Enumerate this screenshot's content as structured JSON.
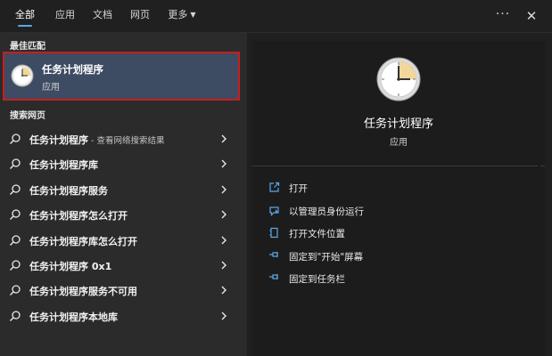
{
  "tabs": [
    {
      "label": "全部",
      "active": true
    },
    {
      "label": "应用",
      "active": false
    },
    {
      "label": "文档",
      "active": false
    },
    {
      "label": "网页",
      "active": false
    },
    {
      "label": "更多",
      "active": false
    }
  ],
  "top_actions": {
    "more_glyph": "···",
    "close_glyph": "✕"
  },
  "best_match": {
    "section_title": "最佳匹配",
    "name": "任务计划程序",
    "type": "应用",
    "icon": "clock-icon"
  },
  "web_search": {
    "section_title": "搜索网页",
    "items": [
      {
        "label": "任务计划程序",
        "suffix": " - 查看网络搜索结果"
      },
      {
        "label": "任务计划程序库",
        "suffix": ""
      },
      {
        "label": "任务计划程序服务",
        "suffix": ""
      },
      {
        "label": "任务计划程序怎么打开",
        "suffix": ""
      },
      {
        "label": "任务计划程序库怎么打开",
        "suffix": ""
      },
      {
        "label": "任务计划程序 0x1",
        "suffix": ""
      },
      {
        "label": "任务计划程序服务不可用",
        "suffix": ""
      },
      {
        "label": "任务计划程序本地库",
        "suffix": ""
      }
    ]
  },
  "preview": {
    "title": "任务计划程序",
    "subtitle": "应用",
    "actions": [
      {
        "label": "打开",
        "icon": "open-icon"
      },
      {
        "label": "以管理员身份运行",
        "icon": "shield-icon"
      },
      {
        "label": "打开文件位置",
        "icon": "file-location-icon"
      },
      {
        "label": "固定到\"开始\"屏幕",
        "icon": "pin-icon"
      },
      {
        "label": "固定到任务栏",
        "icon": "pin-icon"
      }
    ]
  },
  "colors": {
    "accent": "#5aa7e8",
    "selected_bg": "#3d4b63",
    "highlight_border": "#c81e1e"
  }
}
